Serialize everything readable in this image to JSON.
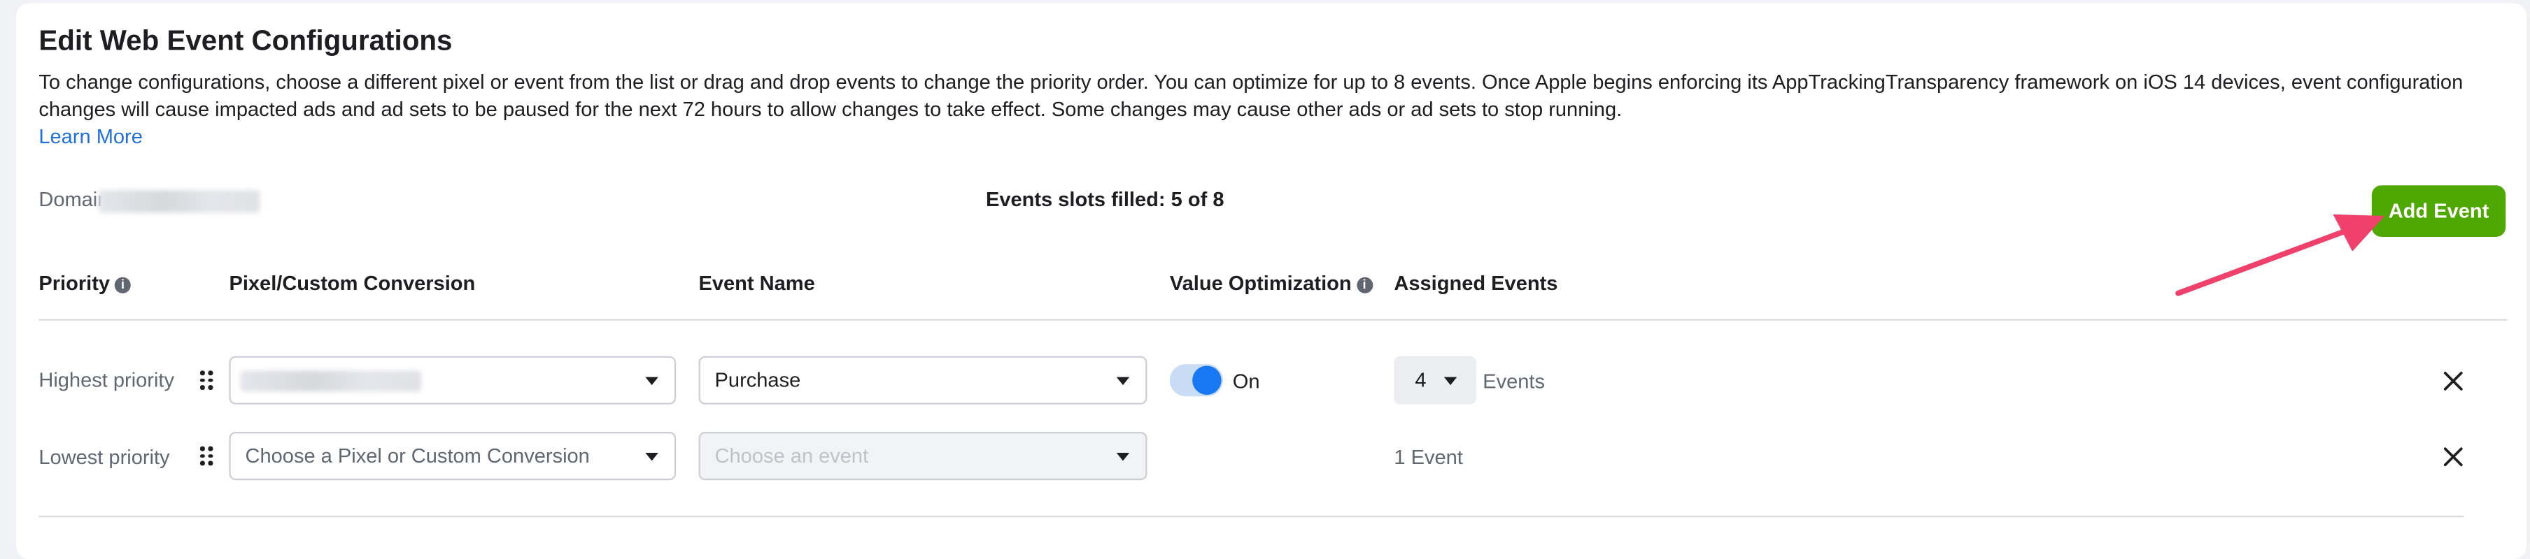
{
  "page": {
    "title": "Edit Web Event Configurations",
    "description": "To change configurations, choose a different pixel or event from the list or drag and drop events to change the priority order. You can optimize for up to 8 events. Once Apple begins enforcing its AppTrackingTransparency framework on iOS 14 devices, event configuration changes will cause impacted ads and ad sets to be paused for the next 72 hours to allow changes to take effect. Some changes may cause other ads or ad sets to stop running.",
    "learn_more": "Learn More"
  },
  "domain": {
    "label": "Domair"
  },
  "slots": {
    "text": "Events slots filled: 5 of 8"
  },
  "toolbar": {
    "add_event_label": "Add Event",
    "add_event_color": "#4fa800"
  },
  "table": {
    "headers": {
      "priority": "Priority",
      "pixel": "Pixel/Custom Conversion",
      "event_name": "Event Name",
      "value_optimization": "Value Optimization",
      "assigned_events": "Assigned Events"
    },
    "rows": [
      {
        "priority_label": "Highest priority",
        "pixel_value": "",
        "event_value": "Purchase",
        "value_optimization": "On",
        "value_optimization_on": true,
        "assigned_count": "4",
        "assigned_suffix": "Events"
      },
      {
        "priority_label": "Lowest priority",
        "pixel_placeholder": "Choose a Pixel or Custom Conversion",
        "event_placeholder": "Choose an event",
        "event_disabled": true,
        "assigned_text": "1 Event"
      }
    ]
  },
  "annotation": {
    "arrow_color": "#f0416c"
  },
  "icons": [
    "info-icon",
    "drag-handle-icon",
    "chevron-down-icon",
    "close-icon"
  ],
  "colors": {
    "accent": "#1877f2",
    "link": "#216fdb",
    "add_button": "#4fa800"
  }
}
